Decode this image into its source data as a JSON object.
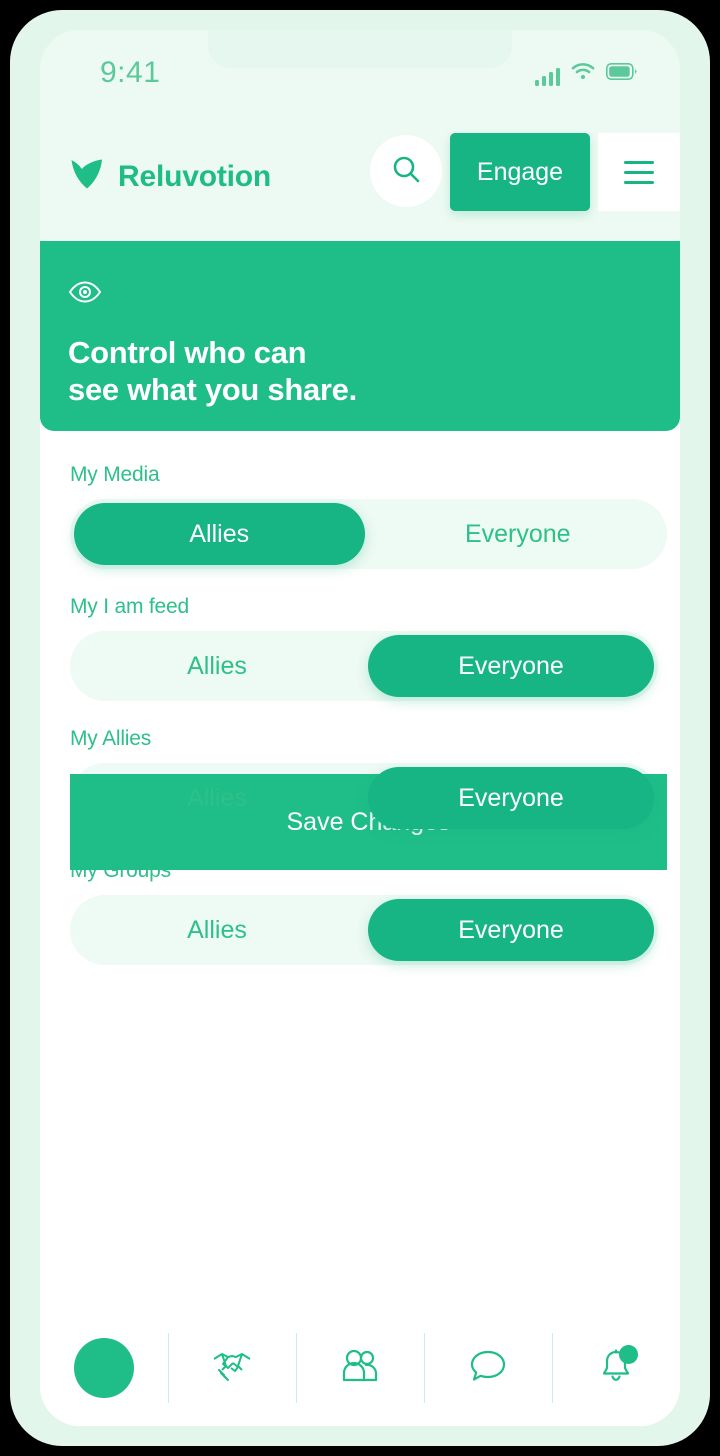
{
  "status_bar": {
    "time": "9:41",
    "icons": [
      "signal-icon",
      "wifi-icon",
      "battery-icon"
    ]
  },
  "header": {
    "logo_icon": "heart-logo-icon",
    "brand": "Reluvotion",
    "search_icon": "search-icon",
    "engage_label": "Engage",
    "menu_icon": "hamburger-menu-icon"
  },
  "hero": {
    "icon": "eye-icon",
    "title": "Control who can\nsee what you share."
  },
  "settings": {
    "rows": [
      {
        "label": "My Media",
        "options": [
          "Allies",
          "Everyone"
        ],
        "selected": "Allies"
      },
      {
        "label": "My I am feed",
        "options": [
          "Allies",
          "Everyone"
        ],
        "selected": "Everyone"
      },
      {
        "label": "My Allies",
        "options": [
          "Allies",
          "Everyone"
        ],
        "selected": "Everyone"
      },
      {
        "label": "My Groups",
        "options": [
          "Allies",
          "Everyone"
        ],
        "selected": "Everyone"
      }
    ]
  },
  "actions": {
    "save_label": "Save Changes"
  },
  "bottom_nav": {
    "items": [
      {
        "name": "profile-avatar",
        "icon": "avatar-circle-icon"
      },
      {
        "name": "allies",
        "icon": "handshake-icon"
      },
      {
        "name": "groups",
        "icon": "people-group-icon"
      },
      {
        "name": "messages",
        "icon": "chat-bubble-icon"
      },
      {
        "name": "notifications",
        "icon": "bell-icon",
        "badge": true
      }
    ]
  },
  "colors": {
    "brand_green": "#1fbd87",
    "accent_green": "#16b583",
    "light_mint": "#eefaf4",
    "frame_mint": "#e2f6ec",
    "status_green": "#5bc99a",
    "label_green": "#2ec08a"
  }
}
